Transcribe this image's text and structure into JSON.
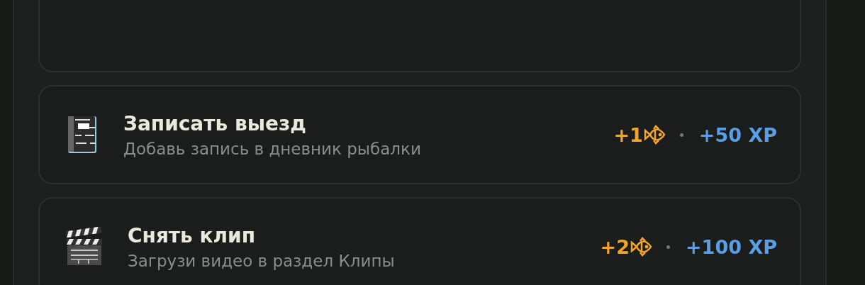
{
  "tasks": [
    {
      "kind": "notebook",
      "title": "Записать выезд",
      "subtitle": "Добавь запись в дневник рыбалки",
      "fish": "+1",
      "xp": "+50 XP"
    },
    {
      "kind": "clapper",
      "title": "Снять клип",
      "subtitle": "Загрузи видео в раздел Клипы",
      "fish": "+2",
      "xp": "+100 XP"
    }
  ]
}
